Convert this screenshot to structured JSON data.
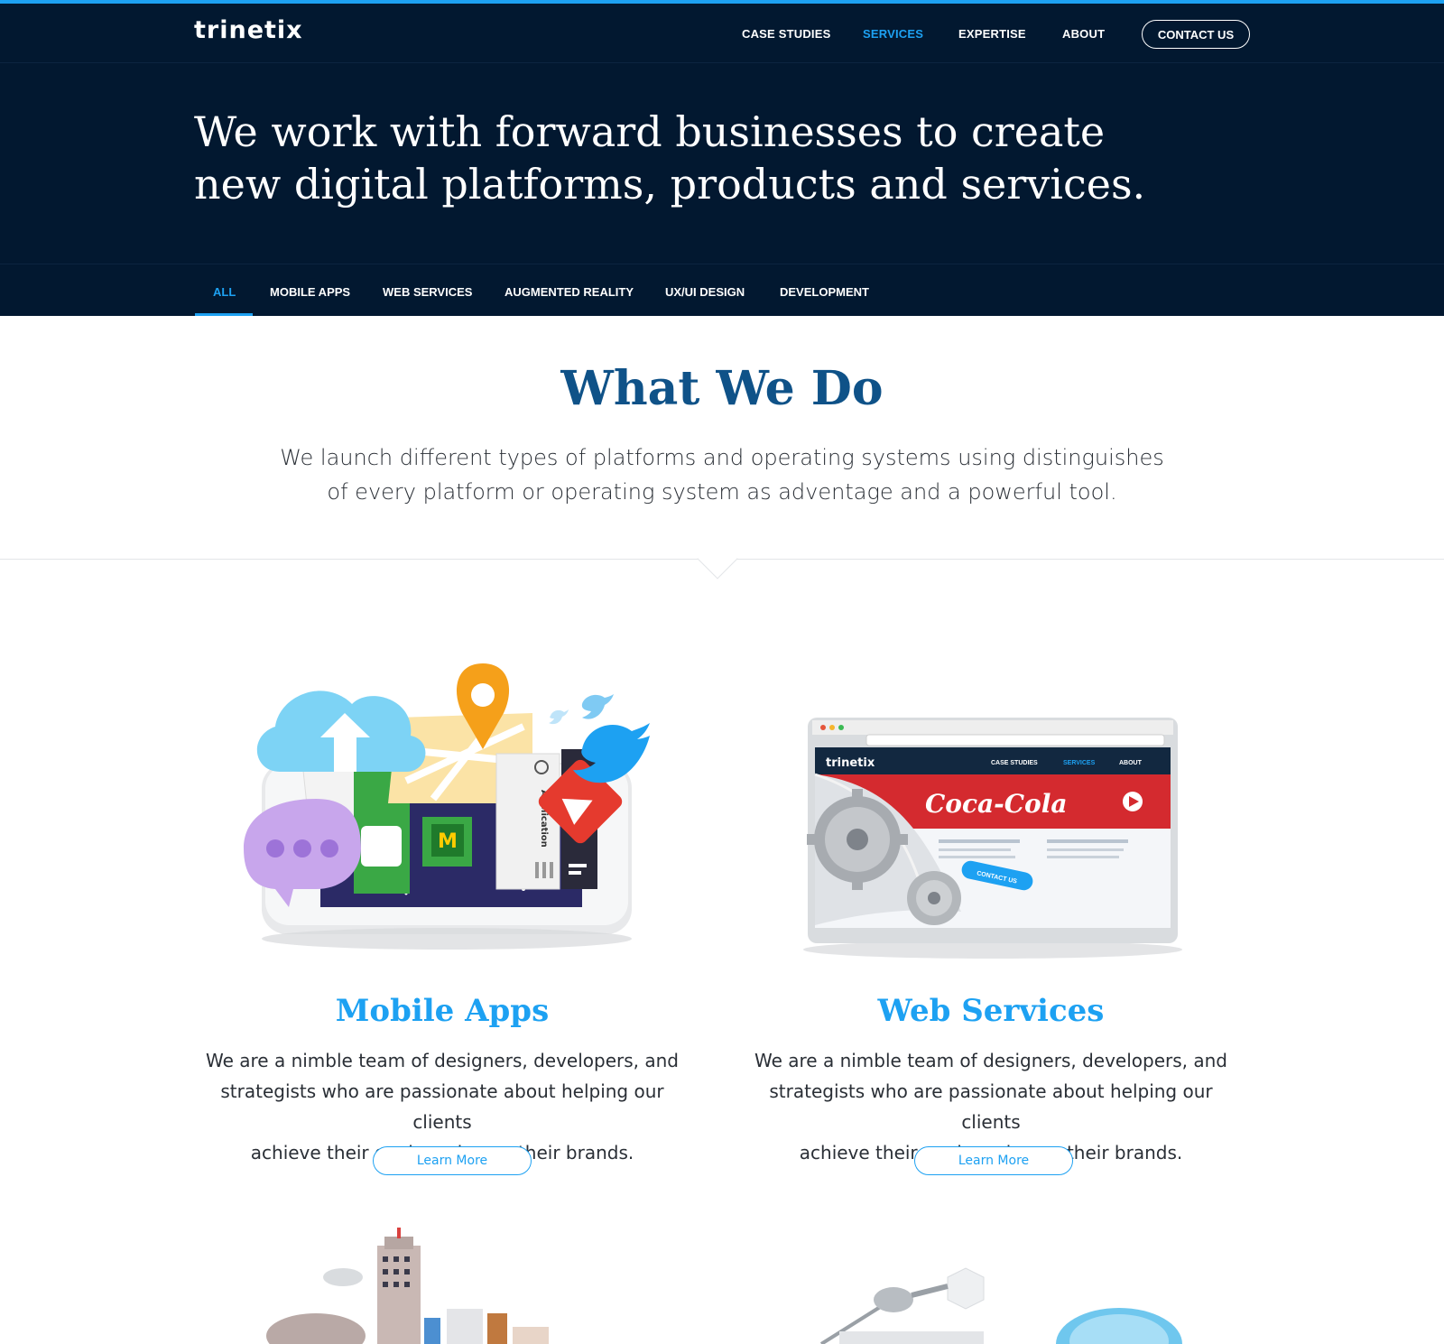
{
  "brand": {
    "logo_text": "Trinetix",
    "accent_color": "#1da1f2",
    "dark_bg": "#021830"
  },
  "nav": {
    "items": [
      {
        "label": "CASE STUDIES",
        "active": false
      },
      {
        "label": "SERVICES",
        "active": true
      },
      {
        "label": "EXPERTISE",
        "active": false
      },
      {
        "label": "ABOUT",
        "active": false
      }
    ],
    "contact_label": "CONTACT US"
  },
  "hero": {
    "line1": "We work with forward businesses to create",
    "line2": "new digital platforms, products and services."
  },
  "tabs": [
    {
      "label": "ALL",
      "active": true
    },
    {
      "label": "MOBILE APPS",
      "active": false
    },
    {
      "label": "WEB SERVICES",
      "active": false
    },
    {
      "label": "AUGMENTED REALITY",
      "active": false
    },
    {
      "label": "UX/UI DESIGN",
      "active": false
    },
    {
      "label": "DEVELOPMENT",
      "active": false
    }
  ],
  "what_we_do": {
    "title": "What We Do",
    "desc_line1": "We launch different types of platforms and operating systems using distinguishes",
    "desc_line2": "of every platform or operating system as adventage and a powerful tool."
  },
  "services": [
    {
      "title": "Mobile Apps",
      "desc_line1": "We are a nimble team of designers, developers, and",
      "desc_line2": "strategists who are passionate about helping our clients",
      "desc_line3": "achieve their goals and grow their brands.",
      "button": "Learn More",
      "illustration": "mobile-apps-illustration",
      "illus_text": "Application"
    },
    {
      "title": "Web Services",
      "desc_line1": "We are a nimble team of designers, developers, and",
      "desc_line2": "strategists who are passionate about helping our clients",
      "desc_line3": "achieve their goals and grow their brands.",
      "button": "Learn More",
      "illustration": "web-services-illustration",
      "browser": {
        "logo": "Trinetix",
        "nav": [
          "CASE STUDIES",
          "SERVICES",
          "ABOUT"
        ],
        "banner": "Coca-Cola",
        "cta": "CONTACT US"
      }
    }
  ]
}
